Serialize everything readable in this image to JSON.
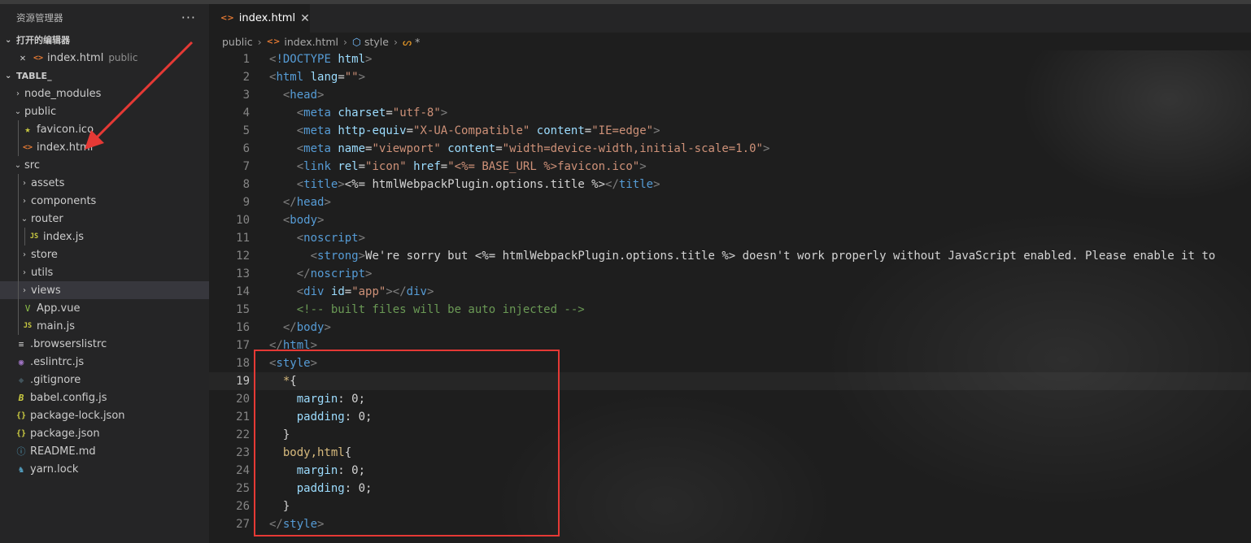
{
  "sidebar": {
    "title": "资源管理器",
    "more_label": "···",
    "open_editors": {
      "label": "打开的编辑器",
      "items": [
        {
          "close": "✕",
          "name": "index.html",
          "desc": "public"
        }
      ]
    },
    "project": {
      "label": "TABLE_",
      "tree": [
        {
          "label": "node_modules",
          "chevron": "›",
          "icon": "",
          "depth": 0
        },
        {
          "label": "public",
          "chevron": "⌄",
          "icon": "",
          "depth": 0
        },
        {
          "label": "favicon.ico",
          "chevron": "",
          "icon": "★",
          "depth": 1
        },
        {
          "label": "index.html",
          "chevron": "",
          "icon": "<>",
          "depth": 1
        },
        {
          "label": "src",
          "chevron": "⌄",
          "icon": "",
          "depth": 0
        },
        {
          "label": "assets",
          "chevron": "›",
          "icon": "",
          "depth": 1
        },
        {
          "label": "components",
          "chevron": "›",
          "icon": "",
          "depth": 1
        },
        {
          "label": "router",
          "chevron": "⌄",
          "icon": "",
          "depth": 1
        },
        {
          "label": "index.js",
          "chevron": "",
          "icon": "JS",
          "depth": 2
        },
        {
          "label": "store",
          "chevron": "›",
          "icon": "",
          "depth": 1
        },
        {
          "label": "utils",
          "chevron": "›",
          "icon": "",
          "depth": 1
        },
        {
          "label": "views",
          "chevron": "›",
          "icon": "",
          "depth": 1
        },
        {
          "label": "App.vue",
          "chevron": "",
          "icon": "V",
          "depth": 1
        },
        {
          "label": "main.js",
          "chevron": "",
          "icon": "JS",
          "depth": 1
        },
        {
          "label": ".browserslistrc",
          "chevron": "",
          "icon": "≡",
          "depth": 0
        },
        {
          "label": ".eslintrc.js",
          "chevron": "",
          "icon": "◉",
          "depth": 0
        },
        {
          "label": ".gitignore",
          "chevron": "",
          "icon": "◆",
          "depth": 0
        },
        {
          "label": "babel.config.js",
          "chevron": "",
          "icon": "B",
          "depth": 0
        },
        {
          "label": "package-lock.json",
          "chevron": "",
          "icon": "{}",
          "depth": 0
        },
        {
          "label": "package.json",
          "chevron": "",
          "icon": "{}",
          "depth": 0
        },
        {
          "label": "README.md",
          "chevron": "",
          "icon": "ⓘ",
          "depth": 0
        },
        {
          "label": "yarn.lock",
          "chevron": "",
          "icon": "♞",
          "depth": 0
        }
      ]
    }
  },
  "editor": {
    "tab": {
      "icon": "<>",
      "label": "index.html",
      "close": "✕"
    },
    "breadcrumbs": [
      "public",
      "index.html",
      "style",
      "*"
    ],
    "current_line": 19,
    "lines": [
      "<!DOCTYPE html>",
      "<html lang=\"\">",
      "  <head>",
      "    <meta charset=\"utf-8\">",
      "    <meta http-equiv=\"X-UA-Compatible\" content=\"IE=edge\">",
      "    <meta name=\"viewport\" content=\"width=device-width,initial-scale=1.0\">",
      "    <link rel=\"icon\" href=\"<%= BASE_URL %>favicon.ico\">",
      "    <title><%= htmlWebpackPlugin.options.title %></title>",
      "  </head>",
      "  <body>",
      "    <noscript>",
      "      <strong>We're sorry but <%= htmlWebpackPlugin.options.title %> doesn't work properly without JavaScript enabled. Please enable it to",
      "    </noscript>",
      "    <div id=\"app\"></div>",
      "    <!-- built files will be auto injected -->",
      "  </body>",
      "</html>",
      "<style>",
      "  *{",
      "    margin: 0;",
      "    padding: 0;",
      "  }",
      "  body,html{",
      "    margin: 0;",
      "    padding: 0;",
      "  }",
      "</style>"
    ]
  },
  "colors": {
    "annotation": "#e53935",
    "html_icon": "#e37933",
    "js_icon": "#cbcb41",
    "vue_icon": "#8dc149"
  }
}
